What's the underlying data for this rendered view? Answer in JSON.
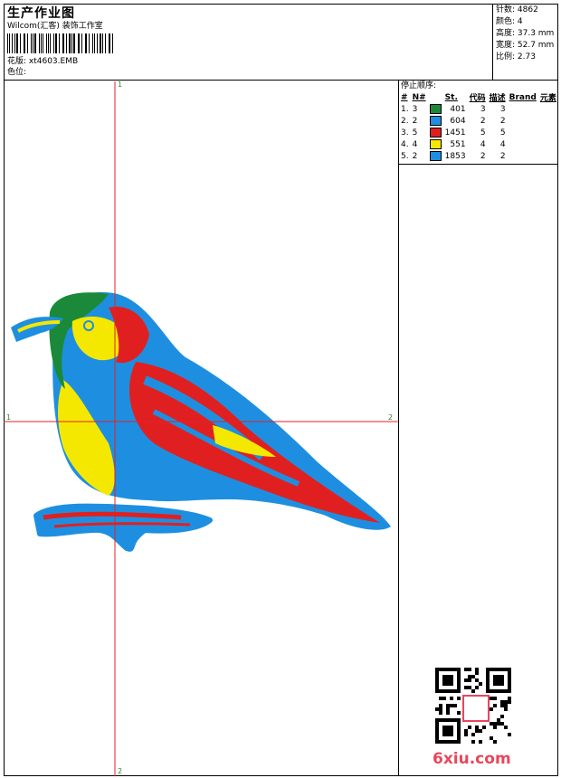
{
  "header": {
    "title": "生产作业图",
    "studio": "Wilcom(汇客) 装饰工作室",
    "design_file": "花版: xt4603.EMB",
    "color_label": "色位:"
  },
  "stats": [
    "针数: 4862",
    "颜色: 4",
    "高度: 37.3 mm",
    "宽度: 52.7 mm",
    "比例: 2.73"
  ],
  "sequence": {
    "title": "停止顺序:",
    "columns": [
      "#",
      "N#",
      "St.",
      "代码",
      "描述",
      "Brand",
      "元素"
    ],
    "rows": [
      {
        "n": "1.",
        "idx": "3",
        "color": "#1a8a3a",
        "st": "401",
        "code": "3",
        "desc": "3"
      },
      {
        "n": "2.",
        "idx": "2",
        "color": "#1e8fe0",
        "st": "604",
        "code": "2",
        "desc": "2"
      },
      {
        "n": "3.",
        "idx": "5",
        "color": "#e02020",
        "st": "1451",
        "code": "5",
        "desc": "5"
      },
      {
        "n": "4.",
        "idx": "4",
        "color": "#f5e800",
        "st": "551",
        "code": "4",
        "desc": "4"
      },
      {
        "n": "5.",
        "idx": "2",
        "color": "#1e8fe0",
        "st": "1853",
        "code": "2",
        "desc": "2"
      }
    ]
  },
  "axis_labels": {
    "top": "1",
    "bottom": "2",
    "left": "1",
    "right": "2"
  },
  "colors": {
    "axis": "#e0222a",
    "blue": "#1e8fe0",
    "red": "#e02020",
    "yellow": "#f5e800",
    "green": "#1a8a3a",
    "watermark": "#e8465b"
  },
  "watermark": "6xiu.com"
}
